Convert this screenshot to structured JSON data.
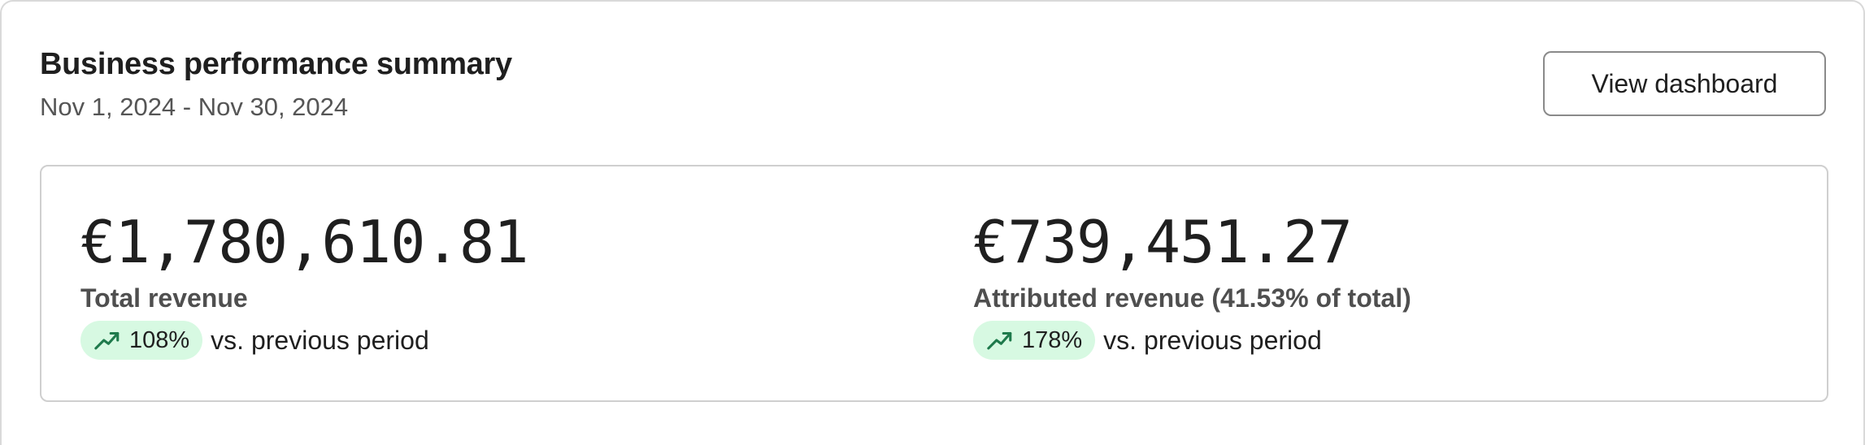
{
  "header": {
    "title": "Business performance summary",
    "date_range": "Nov 1, 2024 - Nov 30, 2024",
    "view_button_label": "View dashboard"
  },
  "metrics": [
    {
      "value": "€1,780,610.81",
      "label": "Total revenue",
      "change": "108%",
      "change_suffix": "vs. previous period",
      "trend_icon": "trending-up-icon"
    },
    {
      "value": "€739,451.27",
      "label": "Attributed revenue (41.53% of total)",
      "change": "178%",
      "change_suffix": "vs. previous period",
      "trend_icon": "trending-up-icon"
    }
  ],
  "colors": {
    "badge_bg": "#d7f9e2",
    "trend_green": "#1f7a4c"
  }
}
